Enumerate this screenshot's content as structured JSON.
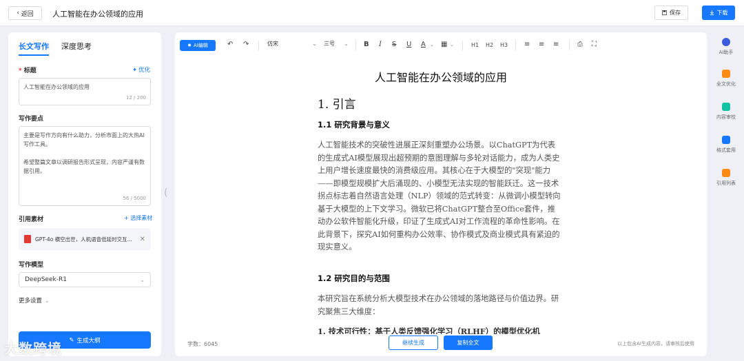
{
  "topbar": {
    "back_label": "返回",
    "title": "人工智能在办公领域的应用",
    "save_label": "保存",
    "download_label": "下载"
  },
  "left": {
    "tabs": [
      {
        "label": "长文写作",
        "active": true
      },
      {
        "label": "深度思考",
        "active": false
      }
    ],
    "title_field": {
      "label": "标题",
      "optimize": "优化",
      "value": "人工智能在办公领域的应用",
      "counter": "12 / 200"
    },
    "points_field": {
      "label": "写作要点",
      "line1": "主要是写作方向有什么助力，分析市面上的大热AI写作工具。",
      "line2": "希望整篇文章以调研报告形式呈现，内容严谨有数据引用。",
      "counter": "56 / 5000"
    },
    "materials": {
      "label": "引用素材",
      "select_link": "+ 选择素材",
      "item": "GPT-4o 横空出世，人机语音低延时交互..."
    },
    "model": {
      "label": "写作模型",
      "value": "DeepSeek-R1"
    },
    "more_settings": "更多设置",
    "generate_label": "生成大纲"
  },
  "editor": {
    "ai_edit_label": "AI编辑",
    "font_family": "仿宋",
    "font_size": "三号",
    "heading_buttons": [
      "H1",
      "H2",
      "H3"
    ],
    "doc": {
      "title": "人工智能在办公领域的应用",
      "h1": "1. 引言",
      "h2_1": "1.1 研究背景与意义",
      "p1": "人工智能技术的突破性进展正深刻重塑办公场景。以ChatGPT为代表的生成式AI模型展现出超预期的意图理解与多轮对话能力，成为人类史上用户增长速度最快的消费级应用。其核心在于大模型的\"突现\"能力——即模型规模扩大后涌现的、小模型无法实现的智能跃迁。这一技术拐点标志着自然语言处理（NLP）领域的范式转变：从微调小模型转向基于大模型的上下文学习。微软已将ChatGPT整合至Office套件，推动办公软件智能化升级，印证了生成式AI对工作流程的革命性影响。在此背景下，探究AI如何重构办公效率、协作模式及商业模式具有紧迫的现实意义。",
      "h2_2": "1.2 研究目的与范围",
      "p2": "本研究旨在系统分析大模型技术在办公领域的落地路径与价值边界。研究聚焦三大维度：",
      "p3": "1. 技术可行性：基于人类反馈强化学习（RLHF）的模型优化机"
    },
    "footer": {
      "word_count": "字数：6045",
      "continue_label": "继续生成",
      "copy_label": "复制全文",
      "disclaimer": "以上包含AI生成内容，请审核后使用"
    }
  },
  "right_tools": [
    {
      "label": "AI助手",
      "icon": "robot-icon",
      "color": "#3b5bdb"
    },
    {
      "label": "全文优化",
      "icon": "document-optimize-icon",
      "color": "#fa8c16"
    },
    {
      "label": "内容审校",
      "icon": "search-check-icon",
      "color": "#13c2a3"
    },
    {
      "label": "格式套用",
      "icon": "format-icon",
      "color": "#1677ff"
    },
    {
      "label": "引用列表",
      "icon": "list-icon",
      "color": "#fa8c16"
    }
  ],
  "watermark": "大数跨境",
  "colors": {
    "accent": "#1677ff",
    "required": "#e53935"
  }
}
